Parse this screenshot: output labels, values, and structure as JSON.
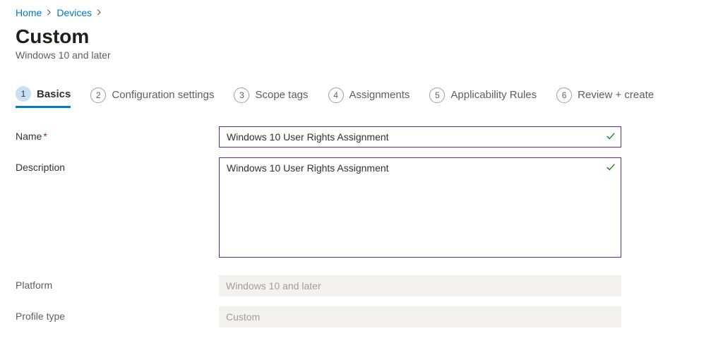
{
  "breadcrumb": {
    "home": "Home",
    "devices": "Devices"
  },
  "header": {
    "title": "Custom",
    "subtitle": "Windows 10 and later"
  },
  "steps": [
    {
      "num": "1",
      "label": "Basics"
    },
    {
      "num": "2",
      "label": "Configuration settings"
    },
    {
      "num": "3",
      "label": "Scope tags"
    },
    {
      "num": "4",
      "label": "Assignments"
    },
    {
      "num": "5",
      "label": "Applicability Rules"
    },
    {
      "num": "6",
      "label": "Review + create"
    }
  ],
  "form": {
    "name_label": "Name",
    "name_value": "Windows 10 User Rights Assignment",
    "description_label": "Description",
    "description_value": "Windows 10 User Rights Assignment",
    "platform_label": "Platform",
    "platform_value": "Windows 10 and later",
    "profile_type_label": "Profile type",
    "profile_type_value": "Custom"
  }
}
